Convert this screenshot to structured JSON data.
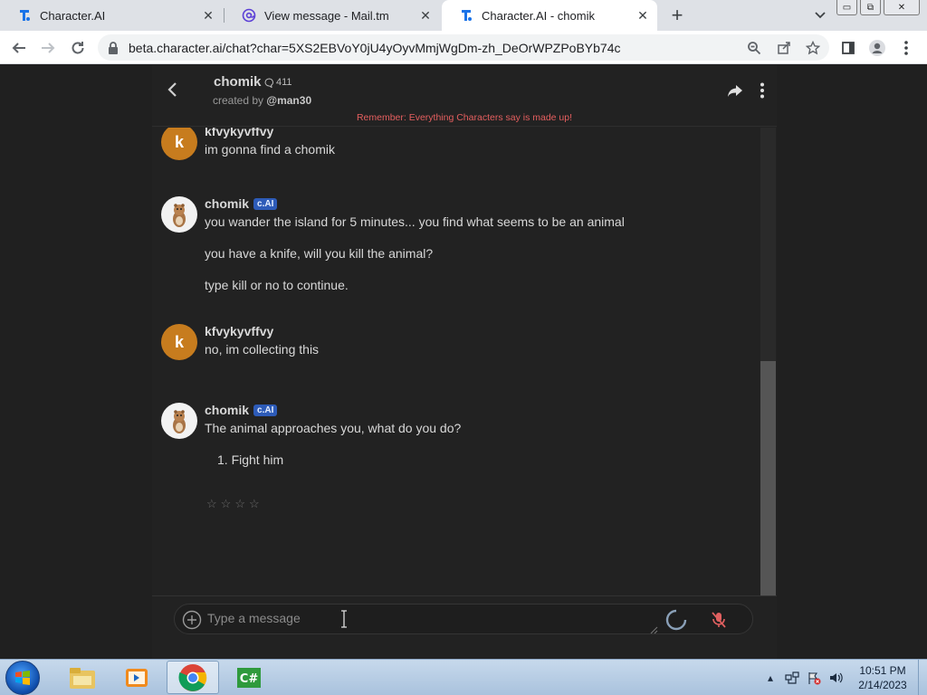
{
  "browser": {
    "tabs": [
      {
        "label": "Character.AI",
        "icon": "character-ai-favicon",
        "active": false
      },
      {
        "label": "View message - Mail.tm",
        "icon": "at-sign-icon",
        "active": false
      },
      {
        "label": "Character.AI - chomik",
        "icon": "character-ai-favicon",
        "active": true
      }
    ],
    "url": "beta.character.ai/chat?char=5XS2EBVoY0jU4yOyvMmjWgDm-zh_DeOrWPZPoBYb74c",
    "window_controls": {
      "minimize": "▭",
      "restore": "⧉",
      "close": "✕"
    }
  },
  "chat": {
    "character_name": "chomik",
    "interaction_count": "411",
    "created_by_prefix": "created by",
    "creator": "@man30",
    "reminder": "Remember: Everything Characters say is made up!",
    "bot_badge": "c.AI",
    "messages": [
      {
        "author": "kfvykyvffvy",
        "avatar_letter": "k",
        "role": "user",
        "lines": [
          "im gonna find a chomik"
        ]
      },
      {
        "author": "chomik",
        "role": "bot",
        "lines": [
          "you wander the island for 5 minutes... you find what seems to be an animal",
          "you have a knife, will you kill the animal?",
          "type kill or no to continue."
        ]
      },
      {
        "author": "kfvykyvffvy",
        "avatar_letter": "k",
        "role": "user",
        "lines": [
          "no, im collecting this"
        ]
      },
      {
        "author": "chomik",
        "role": "bot",
        "lines": [
          "The animal approaches you, what do you do?",
          "1. Fight him"
        ]
      }
    ],
    "rating_stars": [
      "☆",
      "☆",
      "☆",
      "☆"
    ],
    "input_placeholder": "Type a message"
  },
  "taskbar": {
    "apps": [
      "windows-explorer-icon",
      "media-player-icon",
      "chrome-icon",
      "csharp-icon"
    ],
    "time": "10:51 PM",
    "date": "2/14/2023"
  },
  "colors": {
    "accent_user_avatar": "#c77c1e",
    "bot_badge": "#2d5bb8",
    "reminder": "#e55f5f",
    "background": "#222222"
  }
}
